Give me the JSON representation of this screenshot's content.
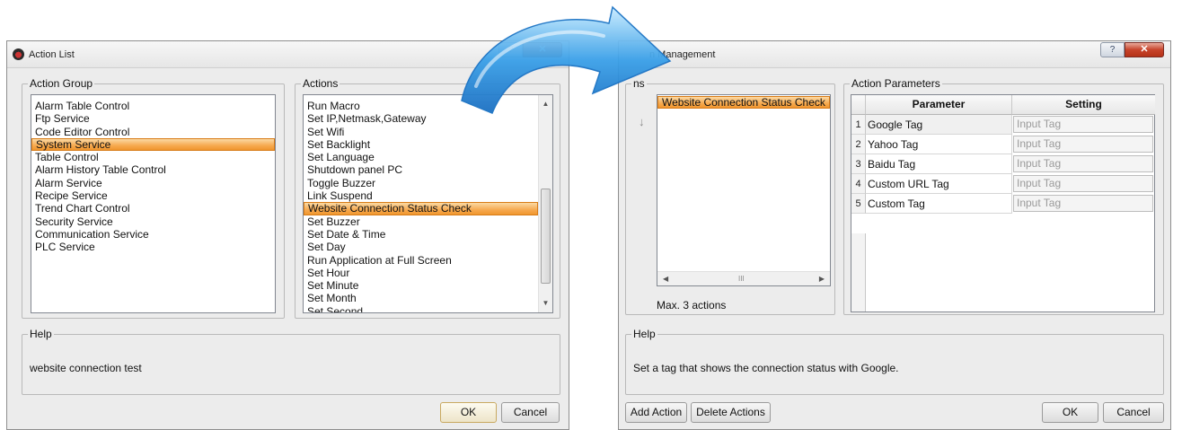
{
  "left_window": {
    "title": "Action List",
    "action_group": {
      "label": "Action Group",
      "items": [
        "Alarm Table Control",
        "Ftp Service",
        "Code Editor Control",
        "System Service",
        "Table Control",
        "Alarm History Table Control",
        "Alarm Service",
        "Recipe Service",
        "Trend Chart Control",
        "Security Service",
        "Communication Service",
        "PLC Service"
      ],
      "selected": "System Service"
    },
    "actions": {
      "label": "Actions",
      "items": [
        "Run Macro",
        "Set IP,Netmask,Gateway",
        "Set Wifi",
        "Set Backlight",
        "Set Language",
        "Shutdown panel PC",
        "Toggle Buzzer",
        "Link Suspend",
        "Website Connection Status Check",
        "Set Buzzer",
        "Set Date & Time",
        "Set Day",
        "Run Application at Full Screen",
        "Set Hour",
        "Set Minute",
        "Set Month",
        "Set Second"
      ],
      "selected": "Website Connection Status Check"
    },
    "help": {
      "label": "Help",
      "text": "website connection test"
    },
    "ok_label": "OK",
    "cancel_label": "Cancel"
  },
  "right_window": {
    "title": "n Management",
    "actions_group_label": "ns",
    "actions_items": [
      "Website Connection Status Check"
    ],
    "max_actions": "Max. 3 actions",
    "params": {
      "label": "Action Parameters",
      "headers": [
        "Parameter",
        "Setting"
      ],
      "rows": [
        {
          "num": "1",
          "param": "Google Tag",
          "setting": "Input Tag"
        },
        {
          "num": "2",
          "param": "Yahoo Tag",
          "setting": "Input Tag"
        },
        {
          "num": "3",
          "param": "Baidu Tag",
          "setting": "Input Tag"
        },
        {
          "num": "4",
          "param": "Custom URL Tag",
          "setting": "Input Tag"
        },
        {
          "num": "5",
          "param": "Custom Tag",
          "setting": "Input Tag"
        }
      ]
    },
    "help": {
      "label": "Help",
      "text": "Set a tag that shows the connection status with Google."
    },
    "add_action_label": "Add Action",
    "delete_actions_label": "Delete Actions",
    "ok_label": "OK",
    "cancel_label": "Cancel"
  },
  "colors": {
    "selection": "#f6a94f",
    "arrow": "#3aa0e8",
    "close": "#c7432a"
  }
}
